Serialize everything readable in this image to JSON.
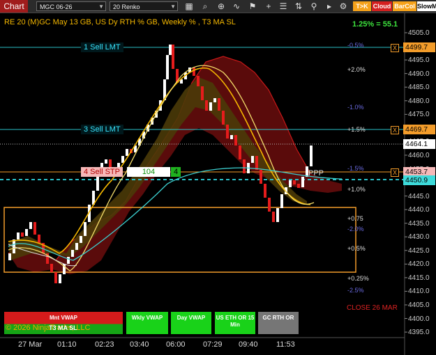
{
  "toolbar": {
    "chart_tab": "Chart",
    "instrument": "MGC 06-26",
    "bar_type": "20 Renko",
    "pills": [
      "T>K",
      "Cloud",
      "BarCol",
      "SlowM"
    ]
  },
  "chart": {
    "title": "RE 20  (M)GC May 13 GB, US Dy RTH % GB, Weekly % , T3 MA SL",
    "correlation": "1.25% = 55.1",
    "price_axis": [
      "4505.0",
      "4500.0",
      "4495.0",
      "4490.0",
      "4485.0",
      "4480.0",
      "4475.0",
      "4470.0",
      "4465.0",
      "4460.0",
      "4455.0",
      "4450.0",
      "4445.0",
      "4440.0",
      "4435.0",
      "4430.0",
      "4425.0",
      "4420.0",
      "4415.0",
      "4410.0",
      "4405.0",
      "4400.0",
      "4395.0"
    ],
    "price_tags": [
      {
        "label": "4499.7",
        "color": "#f39c2a",
        "text_color": "#000"
      },
      {
        "label": "4469.7",
        "color": "#f39c2a",
        "text_color": "#000"
      },
      {
        "label": "4464.1",
        "color": "#ffffff",
        "text_color": "#000"
      },
      {
        "label": "4453.7",
        "color": "#f6b8b8",
        "text_color": "#000"
      },
      {
        "label": "4450.9",
        "color": "#3ddada",
        "text_color": "#000"
      }
    ],
    "orders": {
      "sell_lmt_1": "1  Sell LMT",
      "sell_lmt_3": "3  Sell LMT",
      "sell_stp_4": "4  Sell STP",
      "qty": "104",
      "qty_n": "4",
      "close_x": "X"
    },
    "pct_labels": [
      {
        "text": "-0.5%",
        "style": "b"
      },
      {
        "text": "+2.0%",
        "style": "w"
      },
      {
        "text": "-1.0%",
        "style": "b"
      },
      {
        "text": "+1.5%",
        "style": "w"
      },
      {
        "text": "-1.5%",
        "style": "b"
      },
      {
        "text": "+1.0%",
        "style": "w"
      },
      {
        "text": "+0.75",
        "style": "w"
      },
      {
        "text": "-2.0%",
        "style": "b"
      },
      {
        "text": "+0.5%",
        "style": "w"
      },
      {
        "text": "+0.25%",
        "style": "w"
      },
      {
        "text": "-2.5%",
        "style": "b"
      }
    ],
    "close_label": "CLOSE 26 MAR",
    "ppp": "PPP",
    "buttons": {
      "mnt_vwap": "Mnt VWAP",
      "t3_ma_sl": "T3 MA SL",
      "wkly_vwap": "Wkly VWAP",
      "day_vwap": "Day VWAP",
      "us_eth": "US ETH OR 15 Min",
      "gc_rth": "GC RTH OR"
    },
    "copyright": "© 2026 NinjaTrader, LLC",
    "time_axis": [
      "27 Mar",
      "01:10",
      "02:23",
      "03:40",
      "06:00",
      "07:29",
      "09:40",
      "11:53"
    ]
  }
}
